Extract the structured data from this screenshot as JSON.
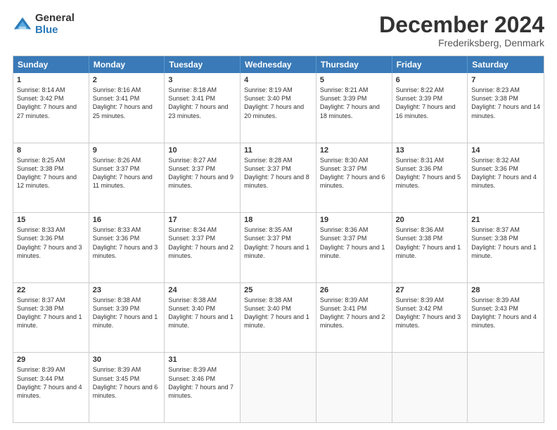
{
  "logo": {
    "general": "General",
    "blue": "Blue"
  },
  "title": "December 2024",
  "location": "Frederiksberg, Denmark",
  "weekdays": [
    "Sunday",
    "Monday",
    "Tuesday",
    "Wednesday",
    "Thursday",
    "Friday",
    "Saturday"
  ],
  "weeks": [
    [
      {
        "day": "1",
        "sunrise": "Sunrise: 8:14 AM",
        "sunset": "Sunset: 3:42 PM",
        "daylight": "Daylight: 7 hours and 27 minutes."
      },
      {
        "day": "2",
        "sunrise": "Sunrise: 8:16 AM",
        "sunset": "Sunset: 3:41 PM",
        "daylight": "Daylight: 7 hours and 25 minutes."
      },
      {
        "day": "3",
        "sunrise": "Sunrise: 8:18 AM",
        "sunset": "Sunset: 3:41 PM",
        "daylight": "Daylight: 7 hours and 23 minutes."
      },
      {
        "day": "4",
        "sunrise": "Sunrise: 8:19 AM",
        "sunset": "Sunset: 3:40 PM",
        "daylight": "Daylight: 7 hours and 20 minutes."
      },
      {
        "day": "5",
        "sunrise": "Sunrise: 8:21 AM",
        "sunset": "Sunset: 3:39 PM",
        "daylight": "Daylight: 7 hours and 18 minutes."
      },
      {
        "day": "6",
        "sunrise": "Sunrise: 8:22 AM",
        "sunset": "Sunset: 3:39 PM",
        "daylight": "Daylight: 7 hours and 16 minutes."
      },
      {
        "day": "7",
        "sunrise": "Sunrise: 8:23 AM",
        "sunset": "Sunset: 3:38 PM",
        "daylight": "Daylight: 7 hours and 14 minutes."
      }
    ],
    [
      {
        "day": "8",
        "sunrise": "Sunrise: 8:25 AM",
        "sunset": "Sunset: 3:38 PM",
        "daylight": "Daylight: 7 hours and 12 minutes."
      },
      {
        "day": "9",
        "sunrise": "Sunrise: 8:26 AM",
        "sunset": "Sunset: 3:37 PM",
        "daylight": "Daylight: 7 hours and 11 minutes."
      },
      {
        "day": "10",
        "sunrise": "Sunrise: 8:27 AM",
        "sunset": "Sunset: 3:37 PM",
        "daylight": "Daylight: 7 hours and 9 minutes."
      },
      {
        "day": "11",
        "sunrise": "Sunrise: 8:28 AM",
        "sunset": "Sunset: 3:37 PM",
        "daylight": "Daylight: 7 hours and 8 minutes."
      },
      {
        "day": "12",
        "sunrise": "Sunrise: 8:30 AM",
        "sunset": "Sunset: 3:37 PM",
        "daylight": "Daylight: 7 hours and 6 minutes."
      },
      {
        "day": "13",
        "sunrise": "Sunrise: 8:31 AM",
        "sunset": "Sunset: 3:36 PM",
        "daylight": "Daylight: 7 hours and 5 minutes."
      },
      {
        "day": "14",
        "sunrise": "Sunrise: 8:32 AM",
        "sunset": "Sunset: 3:36 PM",
        "daylight": "Daylight: 7 hours and 4 minutes."
      }
    ],
    [
      {
        "day": "15",
        "sunrise": "Sunrise: 8:33 AM",
        "sunset": "Sunset: 3:36 PM",
        "daylight": "Daylight: 7 hours and 3 minutes."
      },
      {
        "day": "16",
        "sunrise": "Sunrise: 8:33 AM",
        "sunset": "Sunset: 3:36 PM",
        "daylight": "Daylight: 7 hours and 3 minutes."
      },
      {
        "day": "17",
        "sunrise": "Sunrise: 8:34 AM",
        "sunset": "Sunset: 3:37 PM",
        "daylight": "Daylight: 7 hours and 2 minutes."
      },
      {
        "day": "18",
        "sunrise": "Sunrise: 8:35 AM",
        "sunset": "Sunset: 3:37 PM",
        "daylight": "Daylight: 7 hours and 1 minute."
      },
      {
        "day": "19",
        "sunrise": "Sunrise: 8:36 AM",
        "sunset": "Sunset: 3:37 PM",
        "daylight": "Daylight: 7 hours and 1 minute."
      },
      {
        "day": "20",
        "sunrise": "Sunrise: 8:36 AM",
        "sunset": "Sunset: 3:38 PM",
        "daylight": "Daylight: 7 hours and 1 minute."
      },
      {
        "day": "21",
        "sunrise": "Sunrise: 8:37 AM",
        "sunset": "Sunset: 3:38 PM",
        "daylight": "Daylight: 7 hours and 1 minute."
      }
    ],
    [
      {
        "day": "22",
        "sunrise": "Sunrise: 8:37 AM",
        "sunset": "Sunset: 3:38 PM",
        "daylight": "Daylight: 7 hours and 1 minute."
      },
      {
        "day": "23",
        "sunrise": "Sunrise: 8:38 AM",
        "sunset": "Sunset: 3:39 PM",
        "daylight": "Daylight: 7 hours and 1 minute."
      },
      {
        "day": "24",
        "sunrise": "Sunrise: 8:38 AM",
        "sunset": "Sunset: 3:40 PM",
        "daylight": "Daylight: 7 hours and 1 minute."
      },
      {
        "day": "25",
        "sunrise": "Sunrise: 8:38 AM",
        "sunset": "Sunset: 3:40 PM",
        "daylight": "Daylight: 7 hours and 1 minute."
      },
      {
        "day": "26",
        "sunrise": "Sunrise: 8:39 AM",
        "sunset": "Sunset: 3:41 PM",
        "daylight": "Daylight: 7 hours and 2 minutes."
      },
      {
        "day": "27",
        "sunrise": "Sunrise: 8:39 AM",
        "sunset": "Sunset: 3:42 PM",
        "daylight": "Daylight: 7 hours and 3 minutes."
      },
      {
        "day": "28",
        "sunrise": "Sunrise: 8:39 AM",
        "sunset": "Sunset: 3:43 PM",
        "daylight": "Daylight: 7 hours and 4 minutes."
      }
    ],
    [
      {
        "day": "29",
        "sunrise": "Sunrise: 8:39 AM",
        "sunset": "Sunset: 3:44 PM",
        "daylight": "Daylight: 7 hours and 4 minutes."
      },
      {
        "day": "30",
        "sunrise": "Sunrise: 8:39 AM",
        "sunset": "Sunset: 3:45 PM",
        "daylight": "Daylight: 7 hours and 6 minutes."
      },
      {
        "day": "31",
        "sunrise": "Sunrise: 8:39 AM",
        "sunset": "Sunset: 3:46 PM",
        "daylight": "Daylight: 7 hours and 7 minutes."
      },
      null,
      null,
      null,
      null
    ]
  ]
}
